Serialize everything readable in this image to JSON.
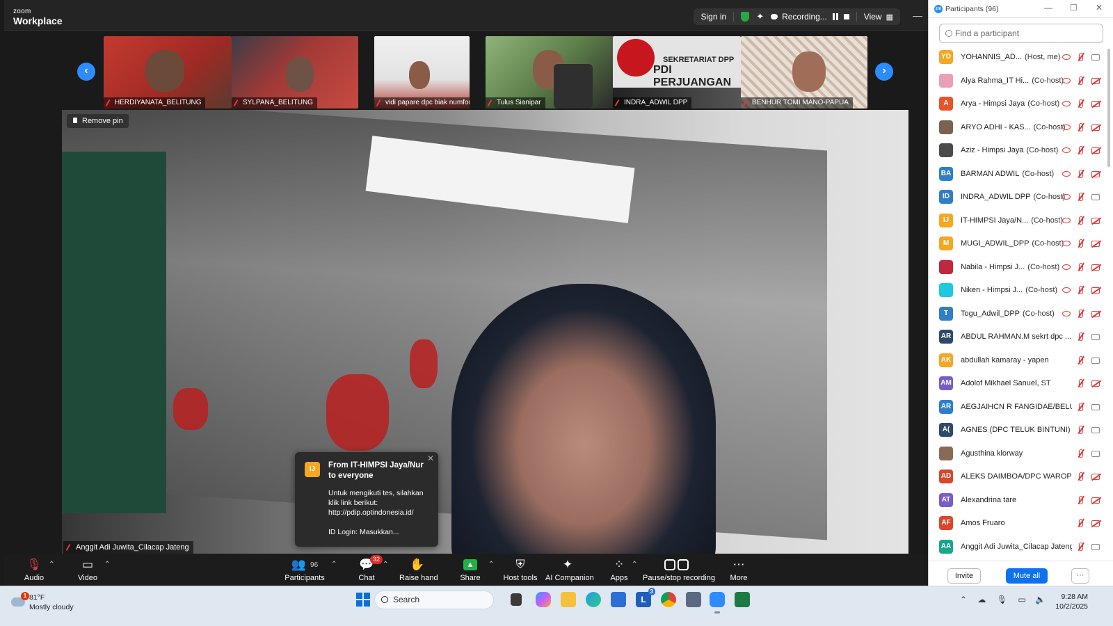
{
  "app": {
    "logo_top": "zoom",
    "logo_bottom": "Workplace"
  },
  "header": {
    "sign_in": "Sign in",
    "recording": "Recording...",
    "view": "View"
  },
  "thumbnails": [
    {
      "name": "HERDIYANATA_BELITUNG",
      "color": "#b23a2e"
    },
    {
      "name": "SYLPANA_BELITUNG",
      "color": "#9a3b36"
    },
    {
      "name": "vidi papare dpc biak numfor",
      "color": "#e9e9e9"
    },
    {
      "name": "Tulus Sianipar",
      "color": "#7a9a6a"
    },
    {
      "name": "INDRA_ADWIL DPP",
      "color": "#d8d8d8"
    },
    {
      "name": "BENHUR TOMI MANO-PAPUA",
      "color": "#cdb9a8"
    }
  ],
  "thumbnail_strip": {
    "poster_line1": "SEKRETARIAT DPP",
    "poster_line2": "PDI PERJUANGAN"
  },
  "main_video": {
    "pin_label": "Remove pin",
    "speaker_name": "Anggit Adi Juwita_Cilacap Jateng"
  },
  "chat_popup": {
    "avatar": "IJ",
    "title": "From IT-HIMPSI Jaya/Nur to everyone",
    "body": "Untuk mengikuti tes, silahkan klik link berikut: http://pdip.optindonesia.id/",
    "line2": "ID Login: Masukkan..."
  },
  "toolbar": {
    "audio": "Audio",
    "video": "Video",
    "participants": "Participants",
    "participants_count": "96",
    "chat": "Chat",
    "chat_badge": "32",
    "raise_hand": "Raise hand",
    "share": "Share",
    "host_tools": "Host tools",
    "ai_companion": "AI Companion",
    "apps": "Apps",
    "pause_recording": "Pause/stop recording",
    "more": "More"
  },
  "panel": {
    "title": "Participants (96)",
    "search_placeholder": "Find a participant",
    "invite": "Invite",
    "mute_all": "Mute all",
    "more": "···"
  },
  "participants": [
    {
      "initials": "YD",
      "color": "#f5a623",
      "name": "YOHANNIS_AD...",
      "role": "(Host, me)",
      "eye": true,
      "cam": "on"
    },
    {
      "initials": "",
      "color": "#e8a0b5",
      "name": "Alya Rahma_IT Hi...",
      "role": "(Co-host)",
      "eye": true,
      "cam": "off"
    },
    {
      "initials": "A",
      "color": "#e8532a",
      "name": "Arya - Himpsi Jaya",
      "role": "(Co-host)",
      "eye": true,
      "cam": "off"
    },
    {
      "initials": "",
      "color": "#7d6150",
      "name": "ARYO ADHI - KAS...",
      "role": "(Co-host)",
      "eye": true,
      "cam": "off"
    },
    {
      "initials": "",
      "color": "#4b4b4b",
      "name": "Aziz - Himpsi Jaya",
      "role": "(Co-host)",
      "eye": true,
      "cam": "off"
    },
    {
      "initials": "BA",
      "color": "#2f7fc8",
      "name": "BARMAN ADWIL",
      "role": "(Co-host)",
      "eye": true,
      "cam": "off"
    },
    {
      "initials": "ID",
      "color": "#2f7fc8",
      "name": "INDRA_ADWIL DPP",
      "role": "(Co-host)",
      "eye": true,
      "cam": "on"
    },
    {
      "initials": "IJ",
      "color": "#f5a623",
      "name": "IT-HIMPSI Jaya/N...",
      "role": "(Co-host)",
      "eye": true,
      "cam": "off"
    },
    {
      "initials": "M",
      "color": "#f5a623",
      "name": "MUGI_ADWIL_DPP",
      "role": "(Co-host)",
      "eye": true,
      "cam": "off"
    },
    {
      "initials": "",
      "color": "#c0283e",
      "name": "Nabila - Himpsi J...",
      "role": "(Co-host)",
      "eye": true,
      "cam": "off"
    },
    {
      "initials": "",
      "color": "#1ec8e0",
      "name": "Niken - Himpsi J...",
      "role": "(Co-host)",
      "eye": true,
      "cam": "off"
    },
    {
      "initials": "T",
      "color": "#2f7fc8",
      "name": "Togu_Adwil_DPP",
      "role": "(Co-host)",
      "eye": true,
      "cam": "off"
    },
    {
      "initials": "AR",
      "color": "#2e4a6b",
      "name": "ABDUL RAHMAN.M sekrt dpc ...",
      "role": "",
      "eye": false,
      "cam": "on"
    },
    {
      "initials": "AK",
      "color": "#f5a623",
      "name": "abdullah kamaray - yapen",
      "role": "",
      "eye": false,
      "cam": "on"
    },
    {
      "initials": "AM",
      "color": "#7a5cc7",
      "name": "Adolof Mikhael Sanuel, ST",
      "role": "",
      "eye": false,
      "cam": "off"
    },
    {
      "initials": "AR",
      "color": "#2f7fc8",
      "name": "AEGJAIHCN R FANGIDAE/BELU",
      "role": "",
      "eye": false,
      "cam": "on"
    },
    {
      "initials": "A(",
      "color": "#2e4a6b",
      "name": "AGNES (DPC TELUK BINTUNI)",
      "role": "",
      "eye": false,
      "cam": "on"
    },
    {
      "initials": "",
      "color": "#8b6a55",
      "name": "Agusthina klorway",
      "role": "",
      "eye": false,
      "cam": "on"
    },
    {
      "initials": "AD",
      "color": "#d9472b",
      "name": "ALEKS DAIMBOA/DPC WAROPEN",
      "role": "",
      "eye": false,
      "cam": "off"
    },
    {
      "initials": "AT",
      "color": "#7a5cc7",
      "name": "Alexandrina tare",
      "role": "",
      "eye": false,
      "cam": "off"
    },
    {
      "initials": "AF",
      "color": "#d9472b",
      "name": "Amos  Fruaro",
      "role": "",
      "eye": false,
      "cam": "off"
    },
    {
      "initials": "AA",
      "color": "#1aa68b",
      "name": "Anggit Adi Juwita_Cilacap Jateng",
      "role": "",
      "eye": false,
      "cam": "on"
    }
  ],
  "taskbar": {
    "weather_badge": "1",
    "temp": "81°F",
    "condition": "Mostly cloudy",
    "search": "Search",
    "app_badge": "3",
    "time": "9:28 AM",
    "date": "10/2/2025"
  }
}
